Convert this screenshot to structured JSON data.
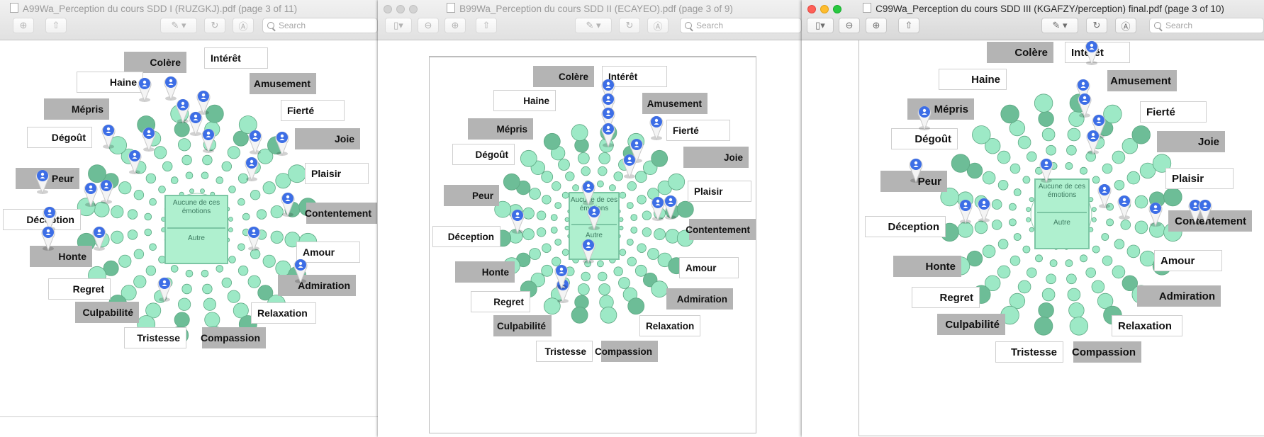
{
  "windows": [
    {
      "id": "w1",
      "title": "A99Wa_Perception du cours SDD I (RUZGKJ).pdf (page 3 of 11)",
      "search_placeholder": "Search",
      "center_top": "Aucune de ces émotions",
      "center_bottom": "Autre"
    },
    {
      "id": "w2",
      "title": "B99Wa_Perception du cours SDD II (ECAYEO).pdf (page 3 of 9)",
      "search_placeholder": "Search",
      "center_top": "Aucune de ces émotions",
      "center_bottom": "Autre"
    },
    {
      "id": "w3",
      "title": "C99Wa_Perception du cours SDD III (KGAFZY/perception) final.pdf (page 3 of 10)",
      "search_placeholder": "Search",
      "center_top": "Aucune de ces émotions",
      "center_bottom": "Autre"
    }
  ],
  "emotions": [
    "Colère",
    "Intérêt",
    "Haine",
    "Amusement",
    "Mépris",
    "Fierté",
    "Dégoût",
    "Joie",
    "Peur",
    "Plaisir",
    "Déception",
    "Contentement",
    "Honte",
    "Amour",
    "Regret",
    "Admiration",
    "Culpabilité",
    "Relaxation",
    "Tristesse",
    "Compassion"
  ],
  "colors": {
    "circle_light": "#9de9c6",
    "circle_dark": "#6dbd97",
    "pin_blue": "#3d6ee6",
    "label_grey": "#b4b4b4"
  },
  "icons": [
    "pin-marker-icon",
    "sidebar-toggle-icon",
    "zoom-out-icon",
    "zoom-in-icon",
    "share-icon",
    "highlighter-icon",
    "rotate-icon",
    "markup-icon",
    "search-icon"
  ]
}
